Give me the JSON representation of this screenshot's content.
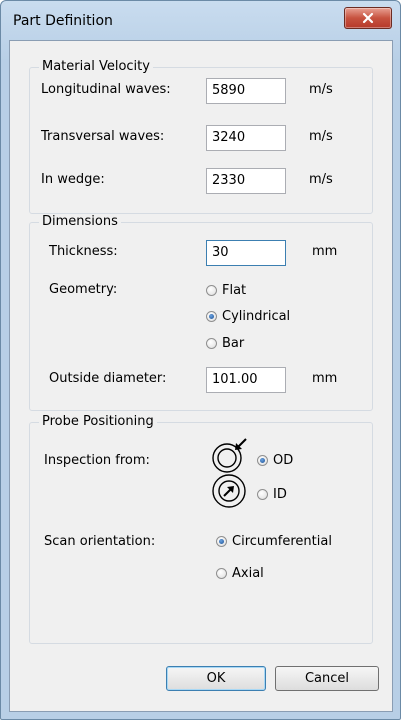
{
  "window": {
    "title": "Part Definition"
  },
  "material_velocity": {
    "legend": "Material Velocity",
    "longitudinal": {
      "label": "Longitudinal waves:",
      "value": "5890",
      "unit": "m/s"
    },
    "transversal": {
      "label": "Transversal waves:",
      "value": "3240",
      "unit": "m/s"
    },
    "wedge": {
      "label": "In wedge:",
      "value": "2330",
      "unit": "m/s"
    }
  },
  "dimensions": {
    "legend": "Dimensions",
    "thickness": {
      "label": "Thickness:",
      "value": "30",
      "unit": "mm"
    },
    "geometry": {
      "label": "Geometry:",
      "options": [
        "Flat",
        "Cylindrical",
        "Bar"
      ],
      "selected": "Cylindrical"
    },
    "outside_diameter": {
      "label": "Outside diameter:",
      "value": "101.00",
      "unit": "mm"
    }
  },
  "probe_positioning": {
    "legend": "Probe Positioning",
    "inspection_from": {
      "label": "Inspection from:",
      "options": [
        "OD",
        "ID"
      ],
      "selected": "OD"
    },
    "scan_orientation": {
      "label": "Scan orientation:",
      "options": [
        "Circumferential",
        "Axial"
      ],
      "selected": "Circumferential"
    }
  },
  "buttons": {
    "ok": "OK",
    "cancel": "Cancel"
  },
  "icons": {
    "close": "close-icon",
    "od": "od-inspection-icon",
    "id": "id-inspection-icon"
  }
}
